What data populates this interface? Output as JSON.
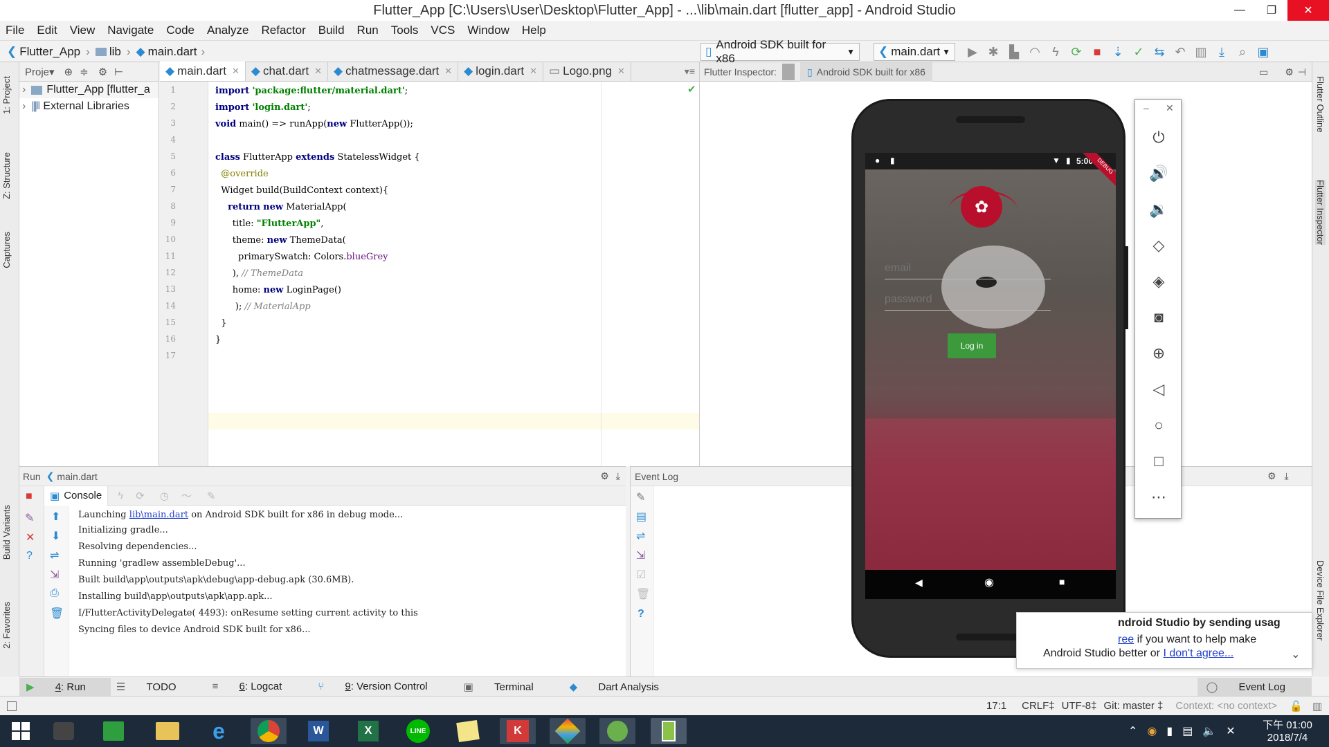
{
  "window": {
    "title": "Flutter_App [C:\\Users\\User\\Desktop\\Flutter_App] - ...\\lib\\main.dart [flutter_app] - Android Studio",
    "minimize": "—",
    "maximize": "❐",
    "close": "✕"
  },
  "menu": [
    "File",
    "Edit",
    "View",
    "Navigate",
    "Code",
    "Analyze",
    "Refactor",
    "Build",
    "Run",
    "Tools",
    "VCS",
    "Window",
    "Help"
  ],
  "breadcrumb": {
    "project": "Flutter_App",
    "folder": "lib",
    "file": "main.dart"
  },
  "toolbar": {
    "device": "Android SDK built for x86",
    "run_config": "main.dart"
  },
  "project_pane": {
    "header": "Proje▾",
    "items": [
      "Flutter_App [flutter_a",
      "External Libraries"
    ]
  },
  "editor": {
    "tabs": [
      "main.dart",
      "chat.dart",
      "chatmessage.dart",
      "login.dart",
      "Logo.png"
    ],
    "line_numbers": [
      "1",
      "2",
      "3",
      "4",
      "5",
      "6",
      "7",
      "8",
      "9",
      "10",
      "11",
      "12",
      "13",
      "14",
      "15",
      "16",
      "17"
    ],
    "code": [
      [
        "kw:import",
        "sp: ",
        "str:'package:flutter/material.dart'",
        "tx:;"
      ],
      [
        "kw:import",
        "sp: ",
        "str:'login.dart'",
        "tx:;"
      ],
      [
        "kw:void",
        "tx: main() => runApp(",
        "kw:new",
        "tx: FlutterApp());"
      ],
      [],
      [
        "kw:class",
        "tx: FlutterApp ",
        "kw:extends",
        "tx: StatelessWidget {"
      ],
      [
        "ann:  @override"
      ],
      [
        "tx:  Widget build(BuildContext context){"
      ],
      [
        "kw:    return",
        "sp: ",
        "kw:new",
        "tx: MaterialApp("
      ],
      [
        "tx:      title: ",
        "str:\"FlutterApp\"",
        "tx:,"
      ],
      [
        "tx:      theme: ",
        "kw:new",
        "tx: ThemeData("
      ],
      [
        "tx:        primarySwatch: Colors.",
        "fld:blueGrey"
      ],
      [
        "tx:      ), ",
        "cmt:// ThemeData"
      ],
      [
        "tx:      home: ",
        "kw:new",
        "tx: LoginPage()"
      ],
      [
        "tx:       ); ",
        "cmt:// MaterialApp"
      ],
      [
        "tx:  }"
      ],
      [
        "tx:}"
      ],
      []
    ]
  },
  "flutter_panel": {
    "label": "Flutter Inspector:",
    "device_tab": "Android SDK built for x86"
  },
  "right_strip": {
    "outline": "Flutter Outline",
    "inspector": "Flutter Inspector",
    "device_files": "Device File Explorer"
  },
  "left_strip": {
    "project": "1: Project",
    "structure": "Z: Structure",
    "captures": "Captures",
    "build_variants": "Build Variants",
    "favorites": "2: Favorites"
  },
  "run_pane": {
    "title": "Run",
    "config": "main.dart",
    "console_tab": "Console",
    "log_prefix": "Launching ",
    "log_link": "lib\\main.dart",
    "log_suffix": " on Android SDK built for x86 in debug mode...",
    "log": [
      "Initializing gradle...",
      "Resolving dependencies...",
      "Running 'gradlew assembleDebug'...",
      "Built build\\app\\outputs\\apk\\debug\\app-debug.apk (30.6MB).",
      "Installing build\\app\\outputs\\apk\\app.apk...",
      "I/FlutterActivityDelegate( 4493): onResume setting current activity to this",
      "Syncing files to device Android SDK built for x86..."
    ]
  },
  "event_log": {
    "title": "Event Log"
  },
  "phone": {
    "time": "5:00",
    "email_placeholder": "email",
    "password_placeholder": "password",
    "login_button": "Log in",
    "debug_ribbon": "DEBUG"
  },
  "notification": {
    "line1": "ndroid Studio by sending usag",
    "line2_link": "ree",
    "line2": " if you want to help make",
    "line3": "Android Studio better or ",
    "line3_link": "I don't agree..."
  },
  "bottom_tools": [
    {
      "key": "4",
      "label": ": Run"
    },
    {
      "key": "",
      "label": "TODO"
    },
    {
      "key": "6",
      "label": ": Logcat"
    },
    {
      "key": "9",
      "label": ": Version Control"
    },
    {
      "key": "",
      "label": "Terminal"
    },
    {
      "key": "",
      "label": "Dart Analysis"
    }
  ],
  "event_log_button": "Event Log",
  "status": {
    "position": "17:1",
    "line_sep": "CRLF‡",
    "encoding": "UTF-8‡",
    "git": "Git: master ‡",
    "context": "Context: <no context>"
  },
  "taskbar": {
    "time": "下午 01:00",
    "date": "2018/7/4"
  },
  "colors": {
    "accent_run": "#4caf50",
    "login_btn": "#3c9a3c",
    "link": "#2140c8"
  }
}
